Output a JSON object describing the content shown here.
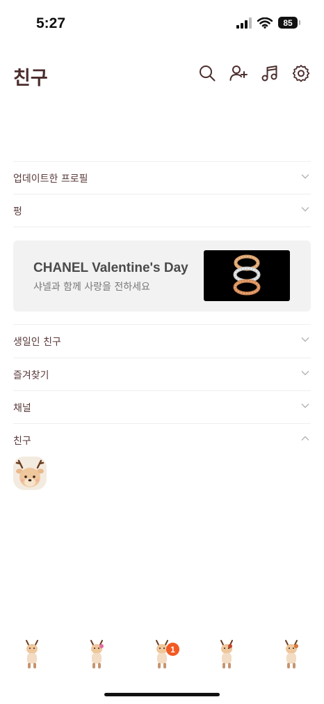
{
  "status_bar": {
    "time": "5:27",
    "battery": "85"
  },
  "header": {
    "title": "친구"
  },
  "sections": {
    "updated_profiles": "업데이트한 프로필",
    "pyeong": "펑",
    "birthday_friends": "생일인 친구",
    "favorites": "즐겨찾기",
    "channels": "채널",
    "friends": "친구"
  },
  "ad": {
    "title": "CHANEL Valentine's Day",
    "subtitle": "샤넬과 함께 사랑을 전하세요"
  },
  "bottom_bar": {
    "badge_count": "1"
  },
  "icons": {
    "header": [
      "search-icon",
      "add-friend-icon",
      "music-icon",
      "settings-icon"
    ],
    "section_collapsed": "chevron-down-icon",
    "section_expanded": "chevron-up-icon"
  },
  "colors": {
    "text": "#5a3a3a",
    "title": "#4b2c2c",
    "badge": "#f25a22",
    "divider": "#f0eded"
  }
}
